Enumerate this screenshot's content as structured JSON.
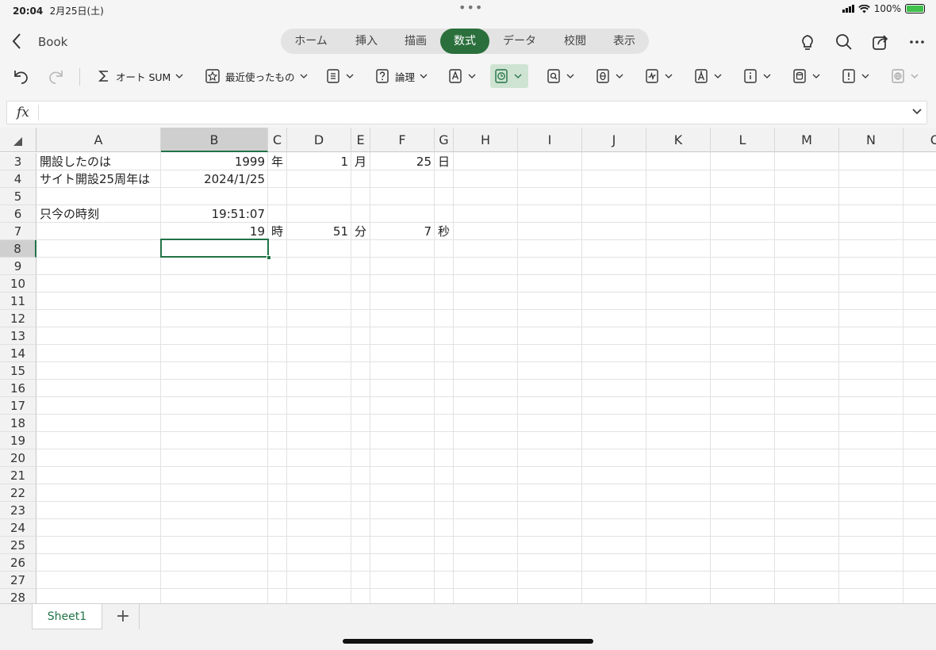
{
  "status": {
    "time": "20:04",
    "date": "2月25日(土)",
    "battery": "100%",
    "dots": "•••"
  },
  "header": {
    "book_name": "Book"
  },
  "tabs": [
    "ホーム",
    "挿入",
    "描画",
    "数式",
    "データ",
    "校閲",
    "表示"
  ],
  "active_tab": "数式",
  "ribbon": {
    "autosum": "オート SUM",
    "recent": "最近使ったもの",
    "logical": "論理"
  },
  "formula_bar": {
    "label": "fx",
    "value": ""
  },
  "columns": [
    "A",
    "B",
    "C",
    "D",
    "E",
    "F",
    "G",
    "H",
    "I",
    "J",
    "K",
    "L",
    "M",
    "N",
    "O"
  ],
  "rows": [
    "3",
    "4",
    "5",
    "6",
    "7",
    "8",
    "9",
    "10",
    "11",
    "12",
    "13",
    "14",
    "15",
    "16",
    "17",
    "18",
    "19",
    "20",
    "21",
    "22",
    "23",
    "24",
    "25",
    "26",
    "27",
    "28"
  ],
  "selected_cell": "B8",
  "cells": {
    "A3": "開設したのは",
    "B3": "1999",
    "C3": "年",
    "D3": "1",
    "E3": "月",
    "F3": "25",
    "G3": "日",
    "A4": "サイト開設25周年は",
    "B4": "2024/1/25",
    "A6": "只今の時刻",
    "B6": "19:51:07",
    "B7": "19",
    "C7": "時",
    "D7": "51",
    "E7": "分",
    "F7": "7",
    "G7": "秒"
  },
  "sheets": {
    "active": "Sheet1",
    "add": "+"
  }
}
